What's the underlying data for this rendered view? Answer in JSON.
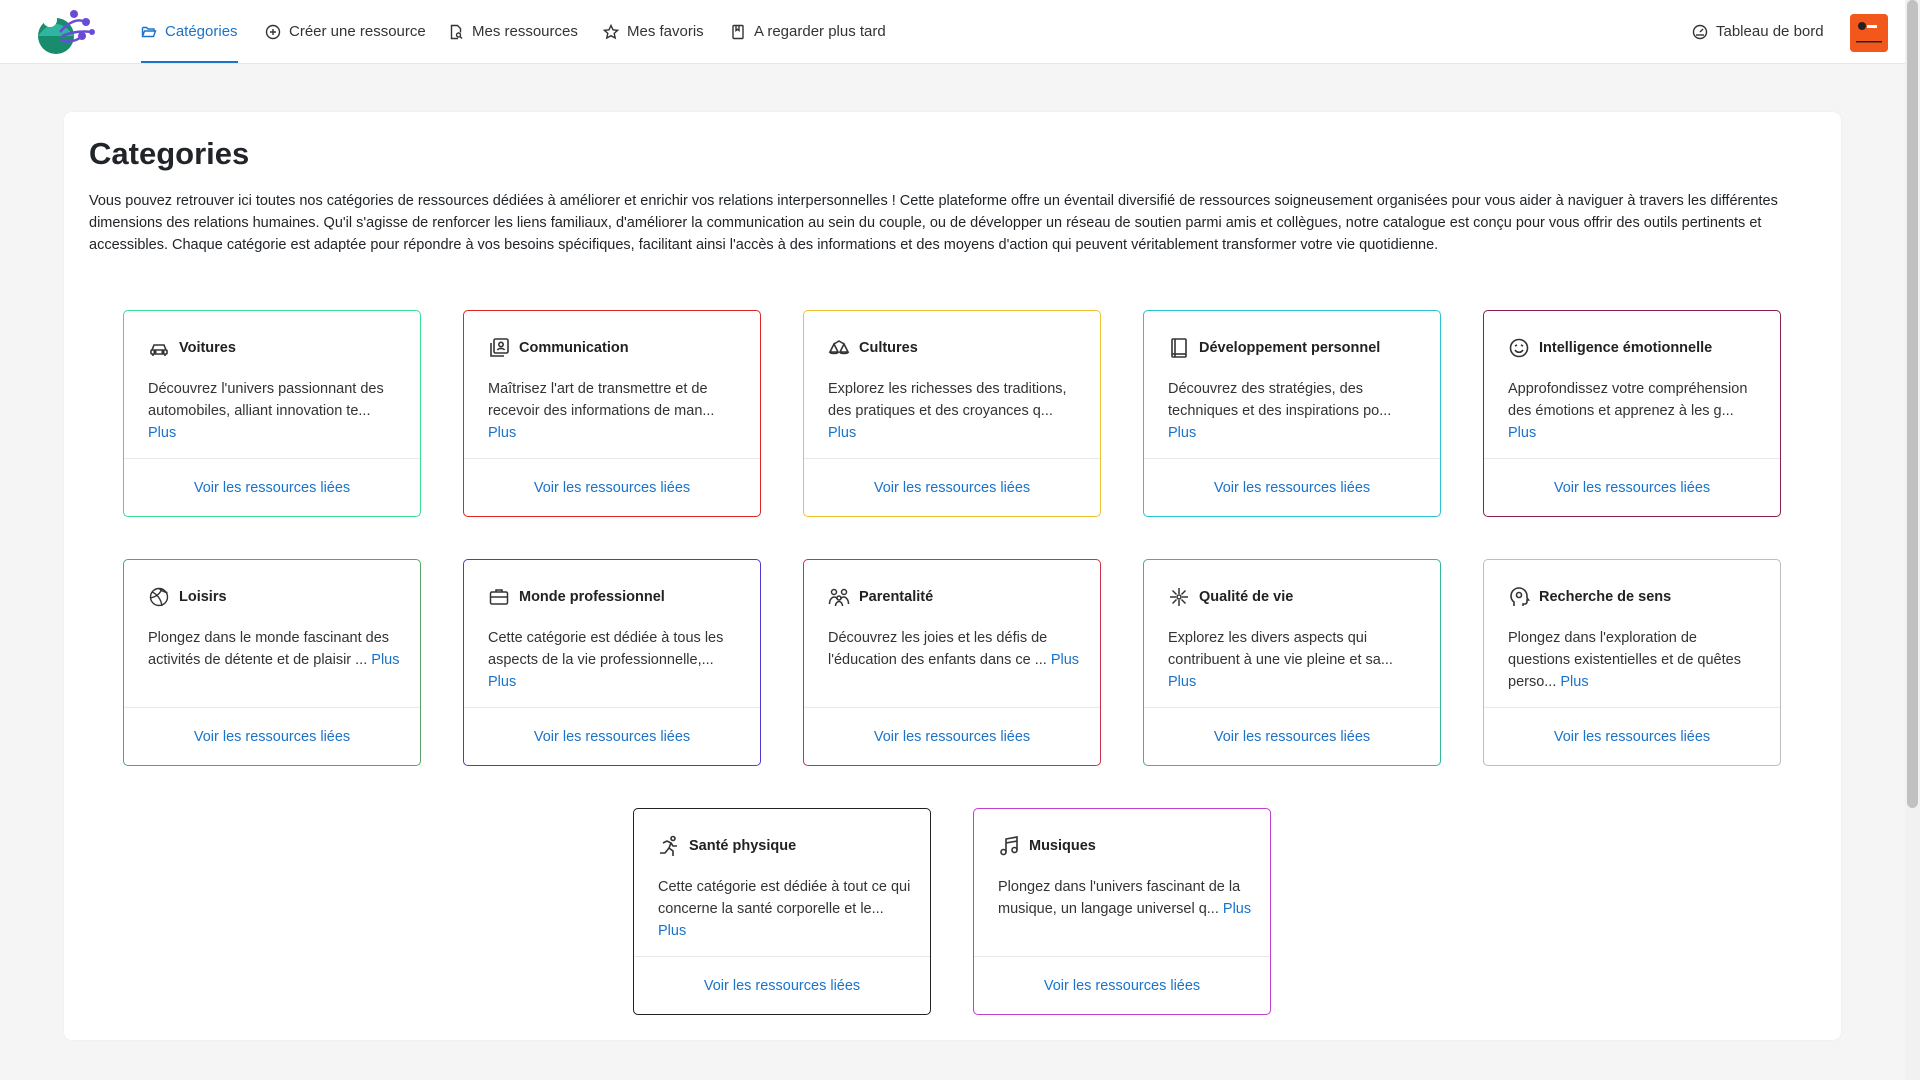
{
  "nav": {
    "items": [
      {
        "label": "Catégories",
        "icon": "folder-open-icon"
      },
      {
        "label": "Créer une ressource",
        "icon": "plus-circle-icon"
      },
      {
        "label": "Mes ressources",
        "icon": "file-search-icon"
      },
      {
        "label": "Mes favoris",
        "icon": "star-icon"
      },
      {
        "label": "A regarder plus tard",
        "icon": "bookmark-icon"
      }
    ],
    "dashboard_label": "Tableau de bord",
    "dashboard_icon": "gauge-icon"
  },
  "colors": {
    "accent": "#1a73c9",
    "avatar": "#f2571c",
    "background": "#f5f5f5"
  },
  "page": {
    "title": "Categories",
    "intro": "Vous pouvez retrouver ici toutes nos catégories de ressources dédiées à améliorer et enrichir vos relations interpersonnelles ! Cette plateforme offre un éventail diversifié de ressources soigneusement organisées pour vous aider à naviguer à travers les différentes dimensions des relations humaines. Qu'il s'agisse de renforcer les liens familiaux, d'améliorer la communication au sein du couple, ou de développer un réseau de soutien parmi amis et collègues, notre catalogue est conçu pour vous offrir des outils pertinents et accessibles. Chaque catégorie est adaptée pour répondre à vos besoins spécifiques, facilitant ainsi l'accès à des informations et des moyens d'action qui peuvent véritablement transformer votre vie quotidienne."
  },
  "categories": [
    {
      "title": "Voitures",
      "icon": "car-icon",
      "color": "#3ddc97",
      "desc": "Découvrez l'univers passionnant des automobiles, alliant innovation te...",
      "more": "Plus",
      "link": "Voir les ressources liées"
    },
    {
      "title": "Communication",
      "icon": "contact-card-icon",
      "color": "#e02424",
      "desc": "Maîtrisez l'art de transmettre et de recevoir des informations de man...",
      "more": "Plus",
      "link": "Voir les ressources liées"
    },
    {
      "title": "Cultures",
      "icon": "scales-icon",
      "color": "#f0c132",
      "desc": "Explorez les richesses des traditions, des pratiques et des croyances q...",
      "more": "Plus",
      "link": "Voir les ressources liées"
    },
    {
      "title": "Développement personnel",
      "icon": "book-icon",
      "color": "#2bc4d0",
      "desc": "Découvrez des stratégies, des techniques et des inspirations po...",
      "more": "Plus",
      "link": "Voir les ressources liées"
    },
    {
      "title": "Intelligence émotionnelle",
      "icon": "smiley-icon",
      "color": "#8a1f4f",
      "desc": "Approfondissez votre compréhension des émotions et apprenez à les g...",
      "more": "Plus",
      "link": "Voir les ressources liées"
    },
    {
      "title": "Loisirs",
      "icon": "ball-icon",
      "color": "#5aa469",
      "desc": "Plongez dans le monde fascinant des activités de détente et de plaisir ...",
      "more": "Plus",
      "link": "Voir les ressources liées"
    },
    {
      "title": "Monde professionnel",
      "icon": "briefcase-icon",
      "color": "#4b3bd1",
      "desc": "Cette catégorie est dédiée à tous les aspects de la vie professionnelle,...",
      "more": "Plus",
      "link": "Voir les ressources liées"
    },
    {
      "title": "Parentalité",
      "icon": "family-icon",
      "color": "#c8324a",
      "desc": "Découvrez les joies et les défis de l'éducation des enfants dans ce ...",
      "more": "Plus",
      "link": "Voir les ressources liées"
    },
    {
      "title": "Qualité de vie",
      "icon": "sparkle-icon",
      "color": "#33b89a",
      "desc": "Explorez les divers aspects qui contribuent à une vie pleine et sa...",
      "more": "Plus",
      "link": "Voir les ressources liées"
    },
    {
      "title": "Recherche de sens",
      "icon": "head-icon",
      "color": "#bdbdbd",
      "desc": "Plongez dans l'exploration de questions existentielles et de quêtes perso...",
      "more": "Plus",
      "link": "Voir les ressources liées"
    },
    {
      "title": "Santé physique",
      "icon": "running-icon",
      "color": "#222222",
      "desc": "Cette catégorie est dédiée à tout ce qui concerne la santé corporelle et le...",
      "more": "Plus",
      "link": "Voir les ressources liées"
    },
    {
      "title": "Musiques",
      "icon": "music-note-icon",
      "color": "#c33fd0",
      "desc": "Plongez dans l'univers fascinant de la musique, un langage universel q...",
      "more": "Plus",
      "link": "Voir les ressources liées"
    }
  ]
}
